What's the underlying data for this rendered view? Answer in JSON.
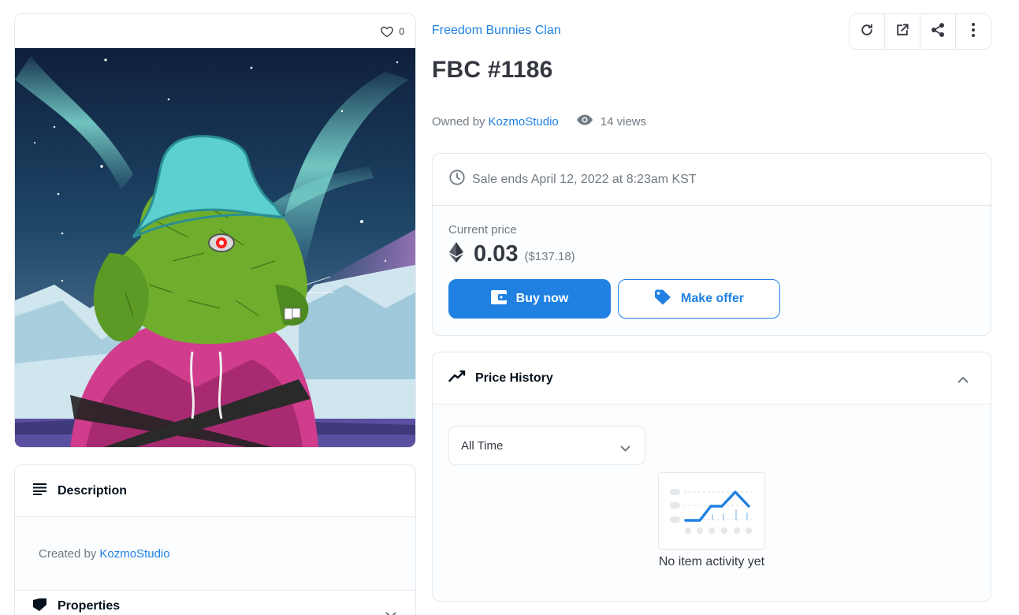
{
  "item": {
    "favorites_count": "0",
    "collection_name": "Freedom Bunnies Clan",
    "title": "FBC #1186",
    "owned_by_label": "Owned by",
    "owner_name": "KozmoStudio",
    "views_text": "14 views"
  },
  "toolbar": {
    "buttons": [
      "refresh-icon",
      "external-link-icon",
      "share-icon",
      "more-icon"
    ]
  },
  "description": {
    "header": "Description",
    "created_by_label": "Created by",
    "creator_name": "KozmoStudio"
  },
  "properties": {
    "header": "Properties"
  },
  "sale": {
    "ends_text": "Sale ends April 12, 2022 at 8:23am KST",
    "current_price_label": "Current price",
    "price": "0.03",
    "price_usd": "($137.18)",
    "buy_label": "Buy now",
    "offer_label": "Make offer"
  },
  "price_history": {
    "header": "Price History",
    "range_selected": "All Time",
    "empty_text": "No item activity yet"
  },
  "colors": {
    "accent": "#2081e2",
    "text": "#353840",
    "muted": "#707a83",
    "border": "#e5e8eb"
  }
}
